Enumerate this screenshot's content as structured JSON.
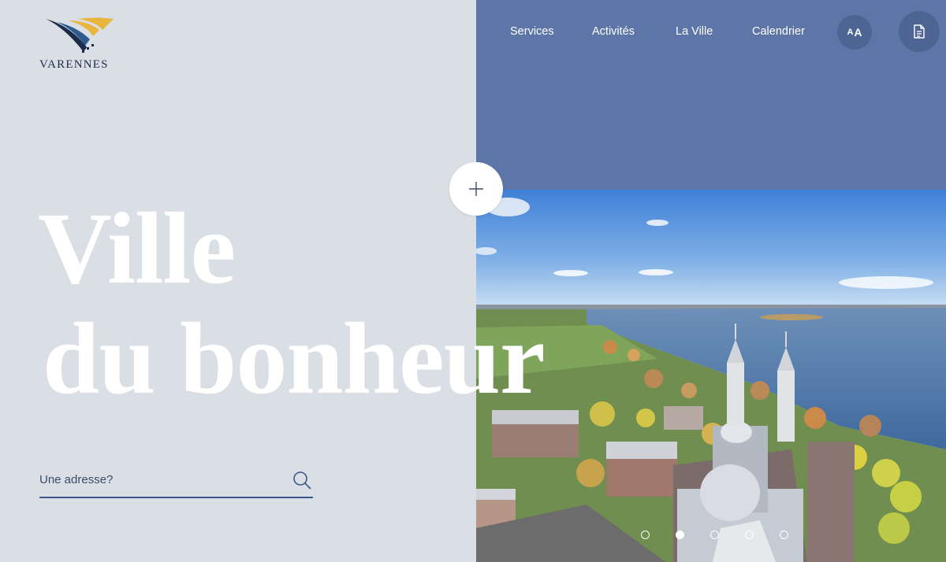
{
  "brand": {
    "name": "VARENNES",
    "logo_icon": "varennes-wing-logo"
  },
  "nav": {
    "links": [
      "Services",
      "Activités",
      "La Ville",
      "Calendrier"
    ],
    "font_toggle_label_small": "A",
    "font_toggle_label_large": "A",
    "font_toggle_icon": "text-size-icon",
    "document_icon": "document-icon"
  },
  "hero": {
    "line1": "Ville",
    "line2": "du bonheur",
    "expand_icon": "plus-icon"
  },
  "search": {
    "placeholder": "Une adresse?",
    "value": "",
    "icon": "search-icon"
  },
  "carousel": {
    "slide_count": 5,
    "active_index": 1
  },
  "colors": {
    "left_bg": "#d9dfe4",
    "nav_band": "#5d76a7",
    "accent_dark": "#3a5688",
    "logo_gold": "#e9b53b",
    "logo_navy": "#1c2b4a"
  }
}
